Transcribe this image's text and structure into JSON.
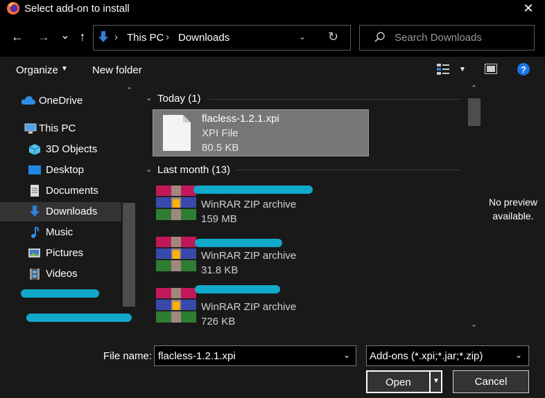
{
  "window": {
    "title": "Select add-on to install",
    "close": "✕"
  },
  "nav": {
    "back": "←",
    "forward": "→",
    "recent": "⌄",
    "up": "↑",
    "breadcrumb": [
      "This PC",
      "Downloads"
    ],
    "separator": "›",
    "search_placeholder": "Search Downloads"
  },
  "toolbar": {
    "organize": "Organize",
    "new_folder": "New folder"
  },
  "sidebar": {
    "items": [
      {
        "label": "OneDrive",
        "icon": "cloud-icon"
      },
      {
        "label": "This PC",
        "icon": "computer-icon"
      },
      {
        "label": "3D Objects",
        "icon": "cube-icon"
      },
      {
        "label": "Desktop",
        "icon": "desktop-icon"
      },
      {
        "label": "Documents",
        "icon": "document-icon"
      },
      {
        "label": "Downloads",
        "icon": "download-icon"
      },
      {
        "label": "Music",
        "icon": "music-icon"
      },
      {
        "label": "Pictures",
        "icon": "pictures-icon"
      },
      {
        "label": "Videos",
        "icon": "video-icon"
      }
    ]
  },
  "files": {
    "groups": [
      {
        "header": "Today (1)"
      },
      {
        "header": "Last month (13)"
      }
    ],
    "items": [
      {
        "name": "flacless-1.2.1.xpi",
        "type": "XPI File",
        "size": "80.5 KB"
      },
      {
        "name": "",
        "type": "WinRAR ZIP archive",
        "size": "159 MB"
      },
      {
        "name": "",
        "type": "WinRAR ZIP archive",
        "size": "31.8 KB"
      },
      {
        "name": "",
        "type": "WinRAR ZIP archive",
        "size": "726 KB"
      }
    ]
  },
  "preview": {
    "line1": "No preview",
    "line2": "available."
  },
  "bottom": {
    "file_name_label": "File name:",
    "file_name_value": "flacless-1.2.1.xpi",
    "filter_value": "Add-ons (*.xpi;*.jar;*.zip)",
    "open": "Open",
    "cancel": "Cancel"
  },
  "colors": {
    "accent": "#2f7fd6",
    "redaction": "#11a9c9",
    "selection": "#777777"
  }
}
